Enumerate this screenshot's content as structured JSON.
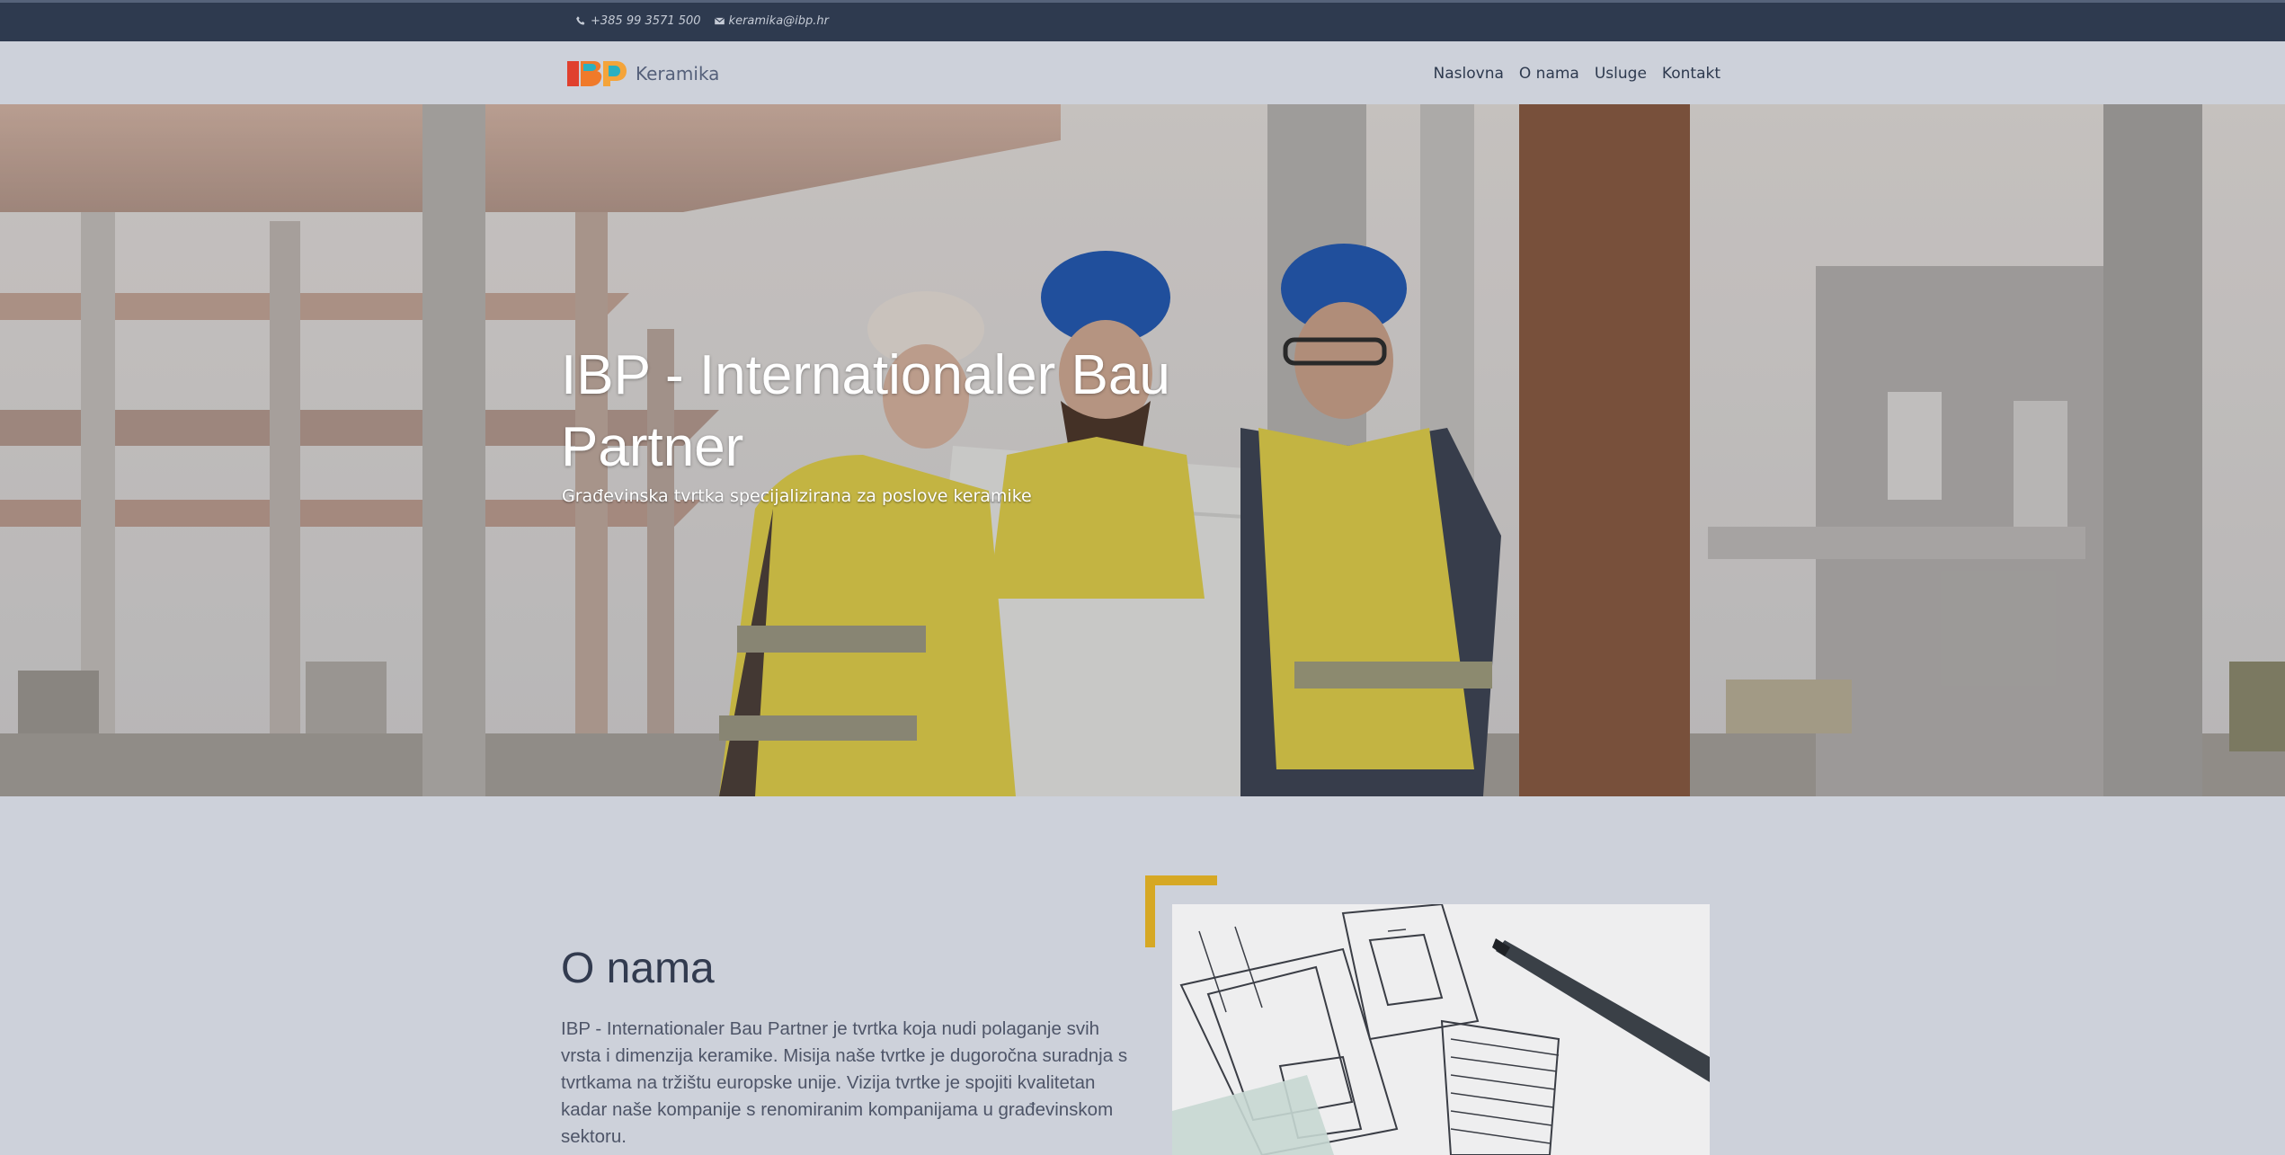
{
  "topbar": {
    "phone": "+385 99 3571 500",
    "email": "keramika@ibp.hr",
    "phone_icon": "phone-icon",
    "email_icon": "envelope-icon"
  },
  "header": {
    "brand_text": "Keramika",
    "logo_icon": "ibp-logo",
    "nav": [
      {
        "label": "Naslovna"
      },
      {
        "label": "O nama"
      },
      {
        "label": "Usluge"
      },
      {
        "label": "Kontakt"
      }
    ]
  },
  "hero": {
    "title": "IBP - Internationaler Bau Partner",
    "subtitle": "Građevinska tvrtka specijalizirana za poslove keramike"
  },
  "about": {
    "title": "O nama",
    "text": "IBP - Internationaler Bau Partner je tvrtka koja nudi polaganje svih vrsta i dimenzija keramike. Misija naše tvrtke je dugoročna suradnja s tvrtkama na tržištu europske unije. Vizija tvrtke je spojiti kvalitetan kadar naše kompanije s renomiranim kompanijama u građevinskom sektoru."
  },
  "colors": {
    "topbar_bg": "#2e3a4f",
    "page_bg": "#cdd1da",
    "accent": "#d6a824"
  }
}
